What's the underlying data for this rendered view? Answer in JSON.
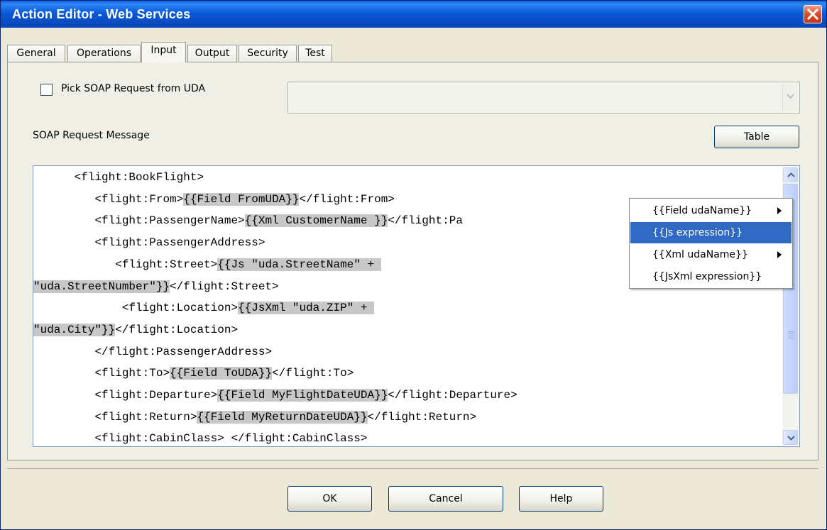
{
  "window": {
    "title": "Action Editor - Web Services"
  },
  "tabs": [
    {
      "label": "General"
    },
    {
      "label": "Operations"
    },
    {
      "label": "Input",
      "active": true
    },
    {
      "label": "Output"
    },
    {
      "label": "Security"
    },
    {
      "label": "Test"
    }
  ],
  "input": {
    "pick_soap_label": "Pick SOAP Request from UDA",
    "pick_soap_checked": false,
    "uda_select_value": "",
    "soap_request_label": "SOAP Request Message",
    "table_button": "Table"
  },
  "editor": {
    "lines": [
      {
        "indent": "      ",
        "parts": [
          {
            "t": "<flight:BookFlight>"
          }
        ]
      },
      {
        "indent": "         ",
        "parts": [
          {
            "t": "<flight:From>"
          },
          {
            "t": "{{Field FromUDA}}",
            "hl": true
          },
          {
            "t": "</flight:From>"
          }
        ]
      },
      {
        "indent": "         ",
        "parts": [
          {
            "t": "<flight:PassengerName>"
          },
          {
            "t": "{{Xml CustomerName }}",
            "hl": true
          },
          {
            "t": "</flight:Pa"
          }
        ]
      },
      {
        "indent": "         ",
        "parts": [
          {
            "t": "<flight:PassengerAddress>"
          }
        ]
      },
      {
        "indent": "            ",
        "parts": [
          {
            "t": "<flight:Street>"
          },
          {
            "t": "{{Js \"uda.StreetName\" + ",
            "hl": true
          }
        ]
      },
      {
        "indent": "",
        "parts": [
          {
            "t": "\"uda.StreetNumber\"}}",
            "hl": true
          },
          {
            "t": "</flight:Street>"
          }
        ]
      },
      {
        "indent": "             ",
        "parts": [
          {
            "t": "<flight:Location>"
          },
          {
            "t": "{{JsXml \"uda.ZIP\" + ",
            "hl": true
          }
        ]
      },
      {
        "indent": "",
        "parts": [
          {
            "t": "\"uda.City\"}}",
            "hl": true
          },
          {
            "t": "</flight:Location>"
          }
        ]
      },
      {
        "indent": "         ",
        "parts": [
          {
            "t": "</flight:PassengerAddress>"
          }
        ]
      },
      {
        "indent": "         ",
        "parts": [
          {
            "t": "<flight:To>"
          },
          {
            "t": "{{Field ToUDA}}",
            "hl": true
          },
          {
            "t": "</flight:To>"
          }
        ]
      },
      {
        "indent": "         ",
        "parts": [
          {
            "t": "<flight:Departure>"
          },
          {
            "t": "{{Field MyFlightDateUDA}}",
            "hl": true
          },
          {
            "t": "</flight:Departure>"
          }
        ]
      },
      {
        "indent": "         ",
        "parts": [
          {
            "t": "<flight:Return>"
          },
          {
            "t": "{{Field MyReturnDateUDA}}",
            "hl": true
          },
          {
            "t": "</flight:Return>"
          }
        ]
      },
      {
        "indent": "         ",
        "parts": [
          {
            "t": "<flight:CabinClass> </flight:CabinClass>"
          }
        ]
      }
    ]
  },
  "context_menu": {
    "items": [
      {
        "label": "{{Field udaName}}",
        "submenu": true
      },
      {
        "label": "{{Js expression}}",
        "selected": true
      },
      {
        "label": "{{Xml udaName}}",
        "submenu": true
      },
      {
        "label": "{{JsXml expression}}"
      }
    ]
  },
  "footer": {
    "ok": "OK",
    "cancel": "Cancel",
    "help": "Help"
  },
  "colors": {
    "titlebar": "#0a5ad8",
    "menu_highlight": "#316ac5",
    "code_highlight": "#c8c8c8"
  }
}
